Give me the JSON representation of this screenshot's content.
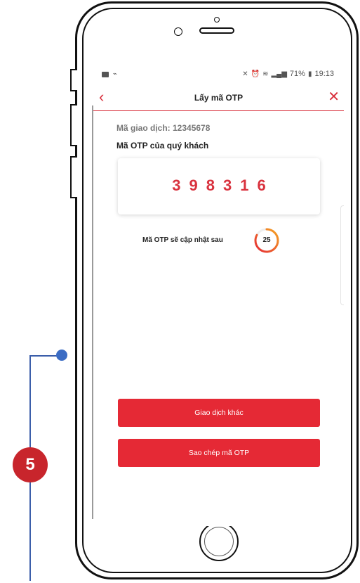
{
  "status_bar": {
    "battery": "71%",
    "time": "19:13",
    "icons": [
      "message-icon",
      "wifi-call-icon",
      "mute-icon",
      "alarm-icon",
      "wifi-icon",
      "data-icon",
      "signal-icon",
      "battery-icon"
    ]
  },
  "header": {
    "title": "Lấy mã OTP",
    "back_icon": "‹",
    "close_icon": "✕"
  },
  "transaction": {
    "label_line": "Mã giao dịch: 12345678"
  },
  "otp": {
    "label": "Mã OTP của quý khách",
    "code": "398316"
  },
  "refresh": {
    "text": "Mã OTP sẽ cập nhật sau",
    "seconds": "25",
    "progress_fraction": 0.83
  },
  "buttons": {
    "other_transaction": "Giao dịch khác",
    "copy_otp": "Sao chép mã OTP"
  },
  "annotation": {
    "step": "5"
  },
  "colors": {
    "accent": "#e52935",
    "otp_text": "#d9323e",
    "countdown_start": "#e52935",
    "countdown_end": "#f5a623",
    "annotation": "#3b6cc4",
    "badge": "#c8252c"
  }
}
